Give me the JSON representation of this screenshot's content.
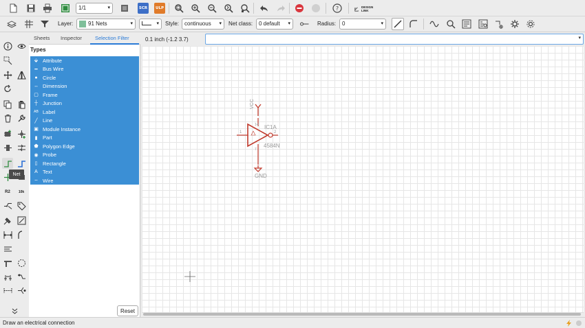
{
  "toolbar": {
    "sheet_combo": "1/1",
    "scr_badge": "SCR",
    "ulp_badge": "ULP",
    "design_link": "DESIGN LINK"
  },
  "toolbar2": {
    "layer_label": "Layer:",
    "layer_value": "91 Nets",
    "layer_color": "#7fbf9a",
    "style_label": "Style:",
    "style_value": "continuous",
    "netclass_label": "Net class:",
    "netclass_value": "0 default",
    "radius_label": "Radius:",
    "radius_value": "0"
  },
  "panel": {
    "tabs": [
      "Sheets",
      "Inspector",
      "Selection Filter"
    ],
    "active_tab": "Selection Filter",
    "types_heading": "Types",
    "types": [
      {
        "label": "Attribute",
        "icon": "tag-icon"
      },
      {
        "label": "Bus Wire",
        "icon": "bus-wire-icon"
      },
      {
        "label": "Circle",
        "icon": "circle-icon"
      },
      {
        "label": "Dimension",
        "icon": "dimension-icon"
      },
      {
        "label": "Frame",
        "icon": "frame-icon"
      },
      {
        "label": "Junction",
        "icon": "junction-icon"
      },
      {
        "label": "Label",
        "icon": "label-icon"
      },
      {
        "label": "Line",
        "icon": "line-icon"
      },
      {
        "label": "Module Instance",
        "icon": "module-icon"
      },
      {
        "label": "Part",
        "icon": "part-icon"
      },
      {
        "label": "Polygon Edge",
        "icon": "polygon-icon"
      },
      {
        "label": "Probe",
        "icon": "probe-icon"
      },
      {
        "label": "Rectangle",
        "icon": "rectangle-icon"
      },
      {
        "label": "Text",
        "icon": "text-icon"
      },
      {
        "label": "Wire",
        "icon": "wire-icon"
      }
    ],
    "selection_color": "#3b8fd5",
    "reset_label": "Reset"
  },
  "canvas": {
    "coordinate": "0.1 inch (-1.2 3.7)",
    "command_value": "",
    "schematic": {
      "vcc_label": "VCC",
      "gnd_label": "GND",
      "part_name": "IC1A",
      "part_value": "4584N",
      "pin_in": "1",
      "pin_out": "2",
      "pin_top": "14",
      "pin_bottom": "7",
      "symbol_color": "#c0392b"
    }
  },
  "iconbar": {
    "r2_label": "R2",
    "tenk_label": "10k",
    "tooltip": "Net"
  },
  "status": {
    "text": "Draw an electrical connection"
  }
}
